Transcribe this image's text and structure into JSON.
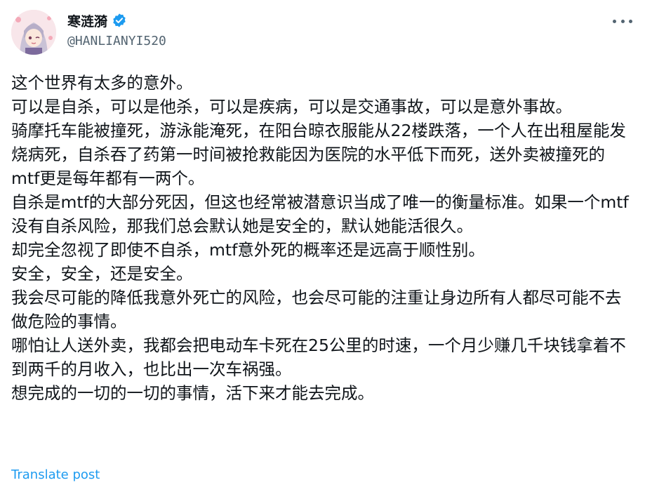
{
  "author": {
    "display_name": "寒涟漪",
    "handle": "@HANLIANYI520",
    "verified_icon": "verified-badge-icon",
    "verified_color": "#1d9bf0"
  },
  "menu_icon": "more-options-icon",
  "post": {
    "lines": [
      "这个世界有太多的意外。",
      "可以是自杀，可以是他杀，可以是疾病，可以是交通事故，可以是意外事故。",
      "骑摩托车能被撞死，游泳能淹死，在阳台晾衣服能从22楼跌落，一个人在出租屋能发烧病死，自杀吞了药第一时间被抢救能因为医院的水平低下而死，送外卖被撞死的mtf更是每年都有一两个。",
      "自杀是mtf的大部分死因，但这也经常被潜意识当成了唯一的衡量标准。如果一个mtf没有自杀风险，那我们总会默认她是安全的，默认她能活很久。",
      "却完全忽视了即使不自杀，mtf意外死的概率还是远高于顺性别。",
      "安全，安全，还是安全。",
      "我会尽可能的降低我意外死亡的风险，也会尽可能的注重让身边所有人都尽可能不去做危险的事情。",
      "哪怕让人送外卖，我都会把电动车卡死在25公里的时速，一个月少赚几千块钱拿着不到两千的月收入，也比出一次车祸强。",
      "想完成的一切的一切的事情，活下来才能去完成。"
    ],
    "translate_label": "Translate post"
  },
  "colors": {
    "text": "#0f1419",
    "secondary": "#536471",
    "link": "#1d9bf0"
  }
}
